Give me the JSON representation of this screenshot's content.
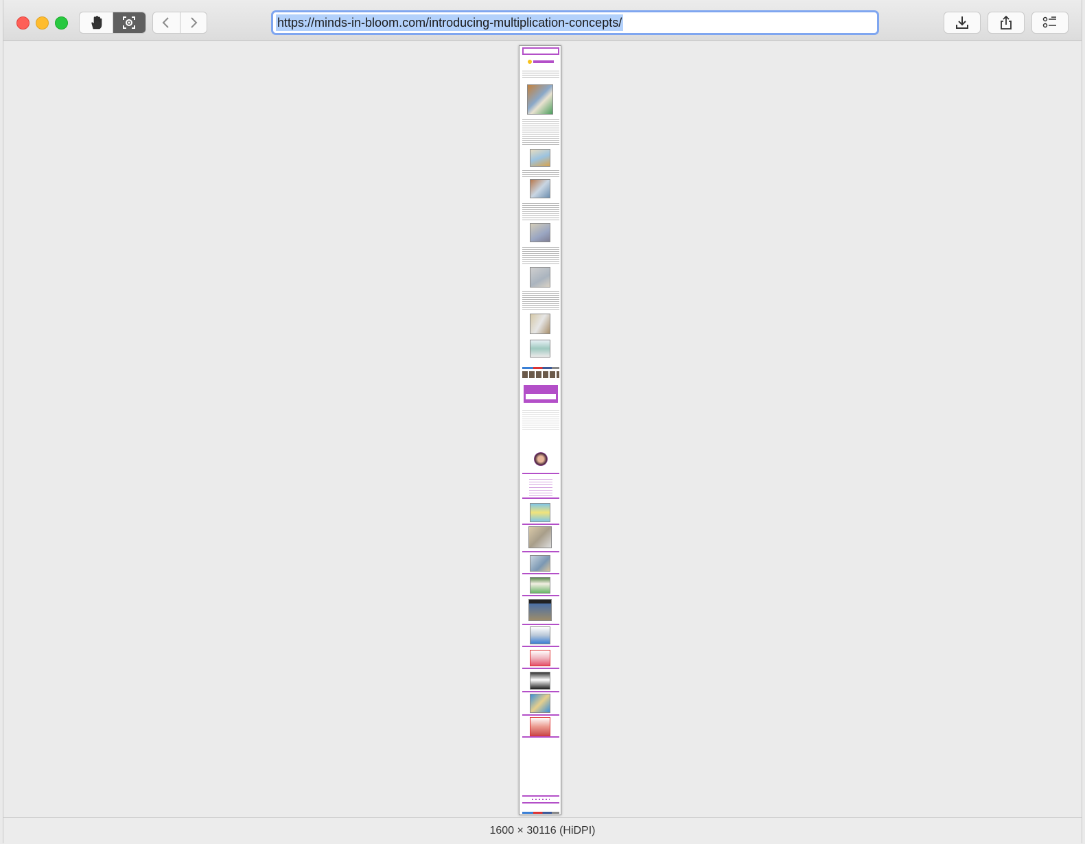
{
  "browser": {
    "url": "https://minds-in-bloom.com/introducing-multiplication-concepts/",
    "status": "1600 × 30116 (HiDPI)",
    "icons": {
      "close": "close-dot",
      "minimize": "minimize-dot",
      "maximize": "maximize-dot",
      "hand": "hand-icon",
      "screenshot": "screenshot-icon",
      "back": "chevron-left-icon",
      "forward": "chevron-right-icon",
      "download": "download-icon",
      "share": "share-icon",
      "menu": "list-icon"
    },
    "colors": {
      "url_highlight": "#b3d1fb",
      "url_border": "#7fa6f0",
      "thumbnail_accent": "#b34fc8"
    }
  }
}
